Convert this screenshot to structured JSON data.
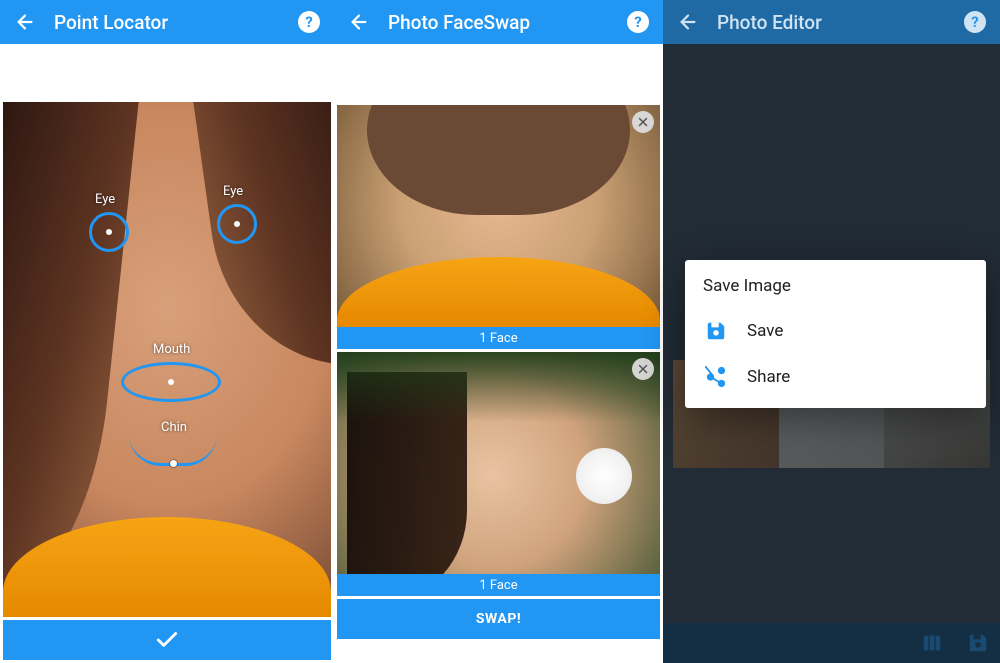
{
  "panel1": {
    "title": "Point Locator",
    "labels": {
      "eye": "Eye",
      "mouth": "Mouth",
      "chin": "Chin"
    },
    "confirm_label": "Confirm"
  },
  "panel2": {
    "title": "Photo FaceSwap",
    "thumb1_caption": "1 Face",
    "thumb2_caption": "1 Face",
    "swap_label": "SWAP!"
  },
  "panel3": {
    "title": "Photo Editor",
    "dialog": {
      "title": "Save Image",
      "save_label": "Save",
      "share_label": "Share"
    }
  }
}
